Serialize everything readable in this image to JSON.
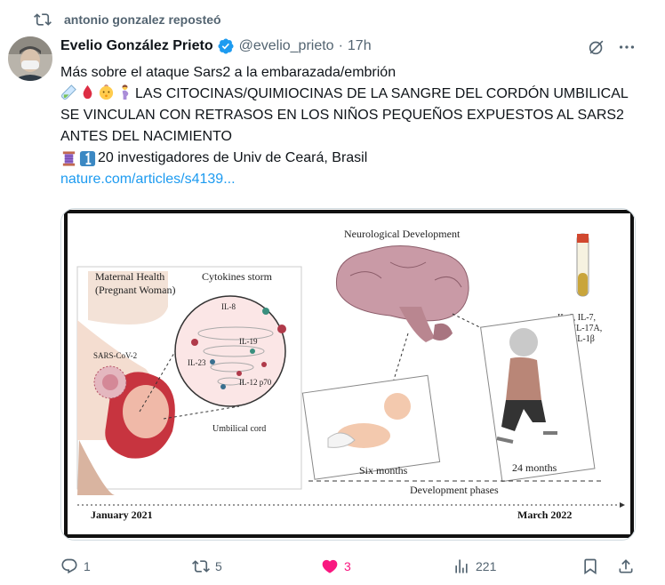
{
  "repost": {
    "icon": "repost-icon",
    "text": "antonio gonzalez reposteó"
  },
  "author": {
    "name": "Evelio González Prieto",
    "verified_icon": "verified-badge-icon",
    "handle": "@evelio_prieto",
    "separator": "·",
    "time": "17h"
  },
  "tweet": {
    "line1": "Más sobre el ataque Sars2 a la embarazada/embrión",
    "line2": "LAS CITOCINAS/QUIMIOCINAS DE LA SANGRE DEL CORDÓN UMBILICAL SE VINCULAN CON RETRASOS EN LOS NIÑOS PEQUEÑOS EXPUESTOS AL SARS2 ANTES DEL NACIMIENTO",
    "line2_emojis": [
      "test-tube-icon",
      "blood-drop-icon",
      "baby-icon",
      "pregnant-woman-icon"
    ],
    "line3": "20 investigadores de Univ de Ceará, Brasil",
    "line3_emojis": [
      "thread-spool-icon",
      "keycap-one-icon"
    ],
    "link": "nature.com/articles/s4139..."
  },
  "figure": {
    "maternal_title_1": "Maternal Health",
    "maternal_title_2": "(Pregnant Woman)",
    "cytokines_title": "Cytokines storm",
    "sars_label": "SARS-CoV-2",
    "il8": "IL-8",
    "il19": "IL-19",
    "il23": "IL-23",
    "il12": "IL-12 p70",
    "umbilical": "Umbilical cord",
    "neuro_title": "Neurological Development",
    "il_list_1": "IL-6, IL-7,",
    "il_list_2": "IL-8, IL-17A,",
    "il_list_3": "and IL-1β",
    "six_months": "Six months",
    "twentyfour_months": "24 months",
    "dev_phases": "Development phases",
    "start_date": "January 2021",
    "end_date": "March 2022"
  },
  "actions": {
    "reply_count": "1",
    "repost_count": "5",
    "like_count": "3",
    "views_count": "221"
  },
  "colors": {
    "accent": "#1d9bf0",
    "like": "#f91880",
    "muted": "#536471"
  }
}
